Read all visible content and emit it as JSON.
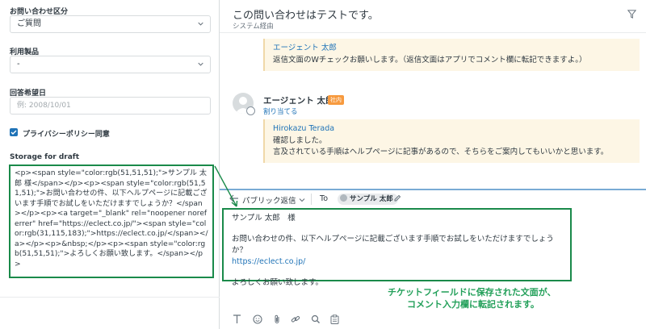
{
  "left": {
    "fields": [
      {
        "label": "お問い合わせ区分",
        "value": "ご質問"
      },
      {
        "label": "利用製品",
        "value": "-"
      },
      {
        "label": "回答希望日",
        "placeholder": "例: 2008/10/01"
      }
    ],
    "privacy_label": "プライバシーポリシー同意",
    "storage_label": "Storage for draft",
    "storage_text": "<p><span style=\"color:rgb(51,51,51);\">サンプル 太郎 様</span></p><p><span style=\"color:rgb(51,51,51);\">お問い合わせの件、以下ヘルプページに記載ございます手順でお試しをいただけますでしょうか？</span></p><p><a target=\"_blank\" rel=\"noopener noreferrer\" href=\"https://eclect.co.jp/\"><span style=\"color:rgb(31,115,183);\">https://eclect.co.jp/</span></a></p><p>&nbsp;</p><p><span style=\"color:rgb(51,51,51);\">よろしくお願い致します。</span></p>"
  },
  "ticket": {
    "title": "この問い合わせはテストです。",
    "subtitle": "システム経由"
  },
  "messages": [
    {
      "author": "エージェント 太郎",
      "body": "返信文面のWチェックお願いします。（返信文面はアプリでコメント欄に転記できますよ。）"
    }
  ],
  "agent": {
    "name": "エージェント 太郎",
    "badge": "社内",
    "assign": "割り当てる"
  },
  "reply_bubble": {
    "author": "Hirokazu Terada",
    "lines": [
      "確認しました。",
      "言及されている手順はヘルプページに記事があるので、そちらをご案内してもいいかと思います。"
    ]
  },
  "composer": {
    "reply_type": "パブリック返信",
    "to_label": "To",
    "recipient": "サンプル 太郎",
    "lines": [
      "サンプル 太郎　様",
      "お問い合わせの件、以下ヘルプページに記載ございます手順でお試しをいただけますでしょうか？",
      "https://eclect.co.jp/",
      "よろしくお願い致します。"
    ]
  },
  "caption": [
    "チケットフィールドに保存された文面が、",
    "コメント入力欄に転記されます。"
  ],
  "toolbar_icons": [
    "text-format-icon",
    "emoji-icon",
    "attachment-icon",
    "link-icon",
    "search-icon",
    "clipboard-icon"
  ],
  "colors": {
    "accent": "#1f73b7",
    "highlight": "#1a8a4a",
    "caption": "#23a05a",
    "bubble": "#fdf6e5",
    "badge": "#f79a3e"
  }
}
